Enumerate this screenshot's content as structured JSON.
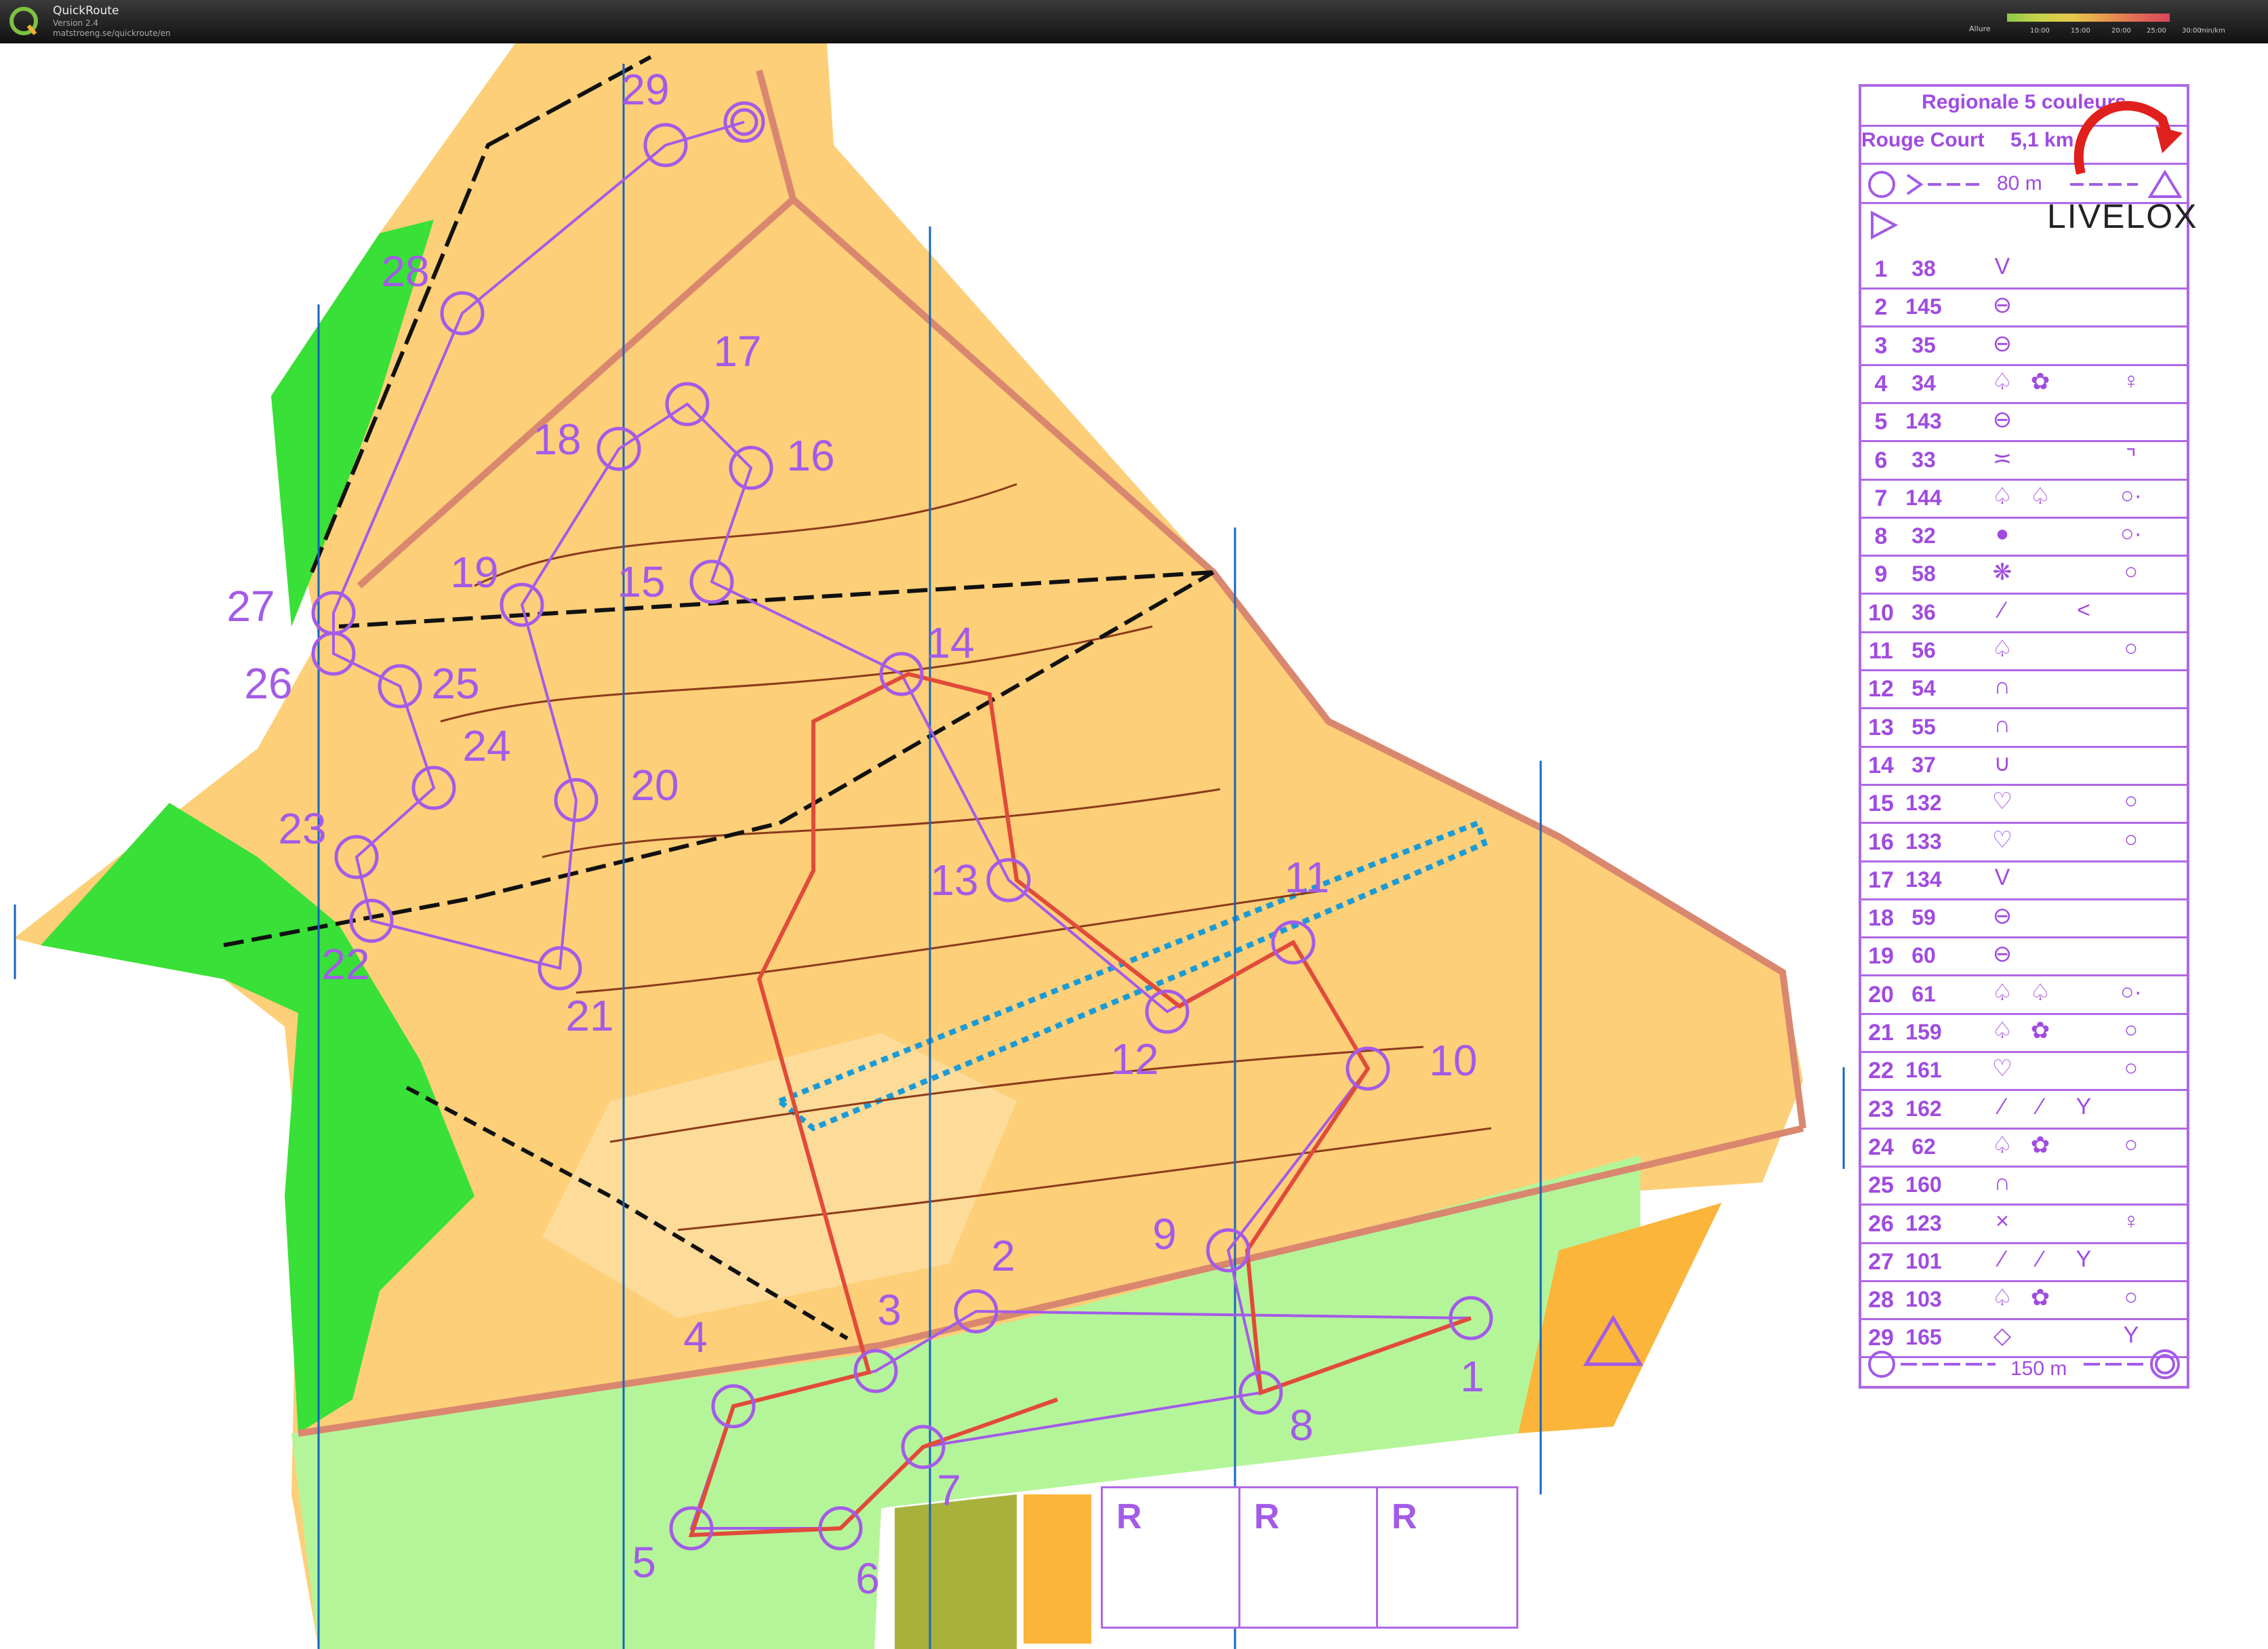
{
  "app": {
    "title": "QuickRoute",
    "version": "Version 2.4",
    "url": "matstroeng.se/quickroute/en",
    "logo_letter": "Q"
  },
  "pace_legend": {
    "label": "Allure",
    "ticks": [
      "10:00",
      "15:00",
      "20:00",
      "25:00",
      "30:00"
    ],
    "unit": "min/km"
  },
  "course": {
    "event": "Regionale 5 couleurs",
    "name": "Rouge Court",
    "distance": "5,1 km",
    "start_leg": "80 m",
    "finish_leg": "150 m",
    "controls": [
      {
        "n": "1",
        "code": "38",
        "c1": "V",
        "c2": "",
        "c3": "",
        "c4": ""
      },
      {
        "n": "2",
        "code": "145",
        "c1": "⊖",
        "c2": "",
        "c3": "",
        "c4": ""
      },
      {
        "n": "3",
        "code": "35",
        "c1": "⊖",
        "c2": "",
        "c3": "",
        "c4": ""
      },
      {
        "n": "4",
        "code": "34",
        "c1": "♤",
        "c2": "✿",
        "c3": "",
        "c4": "♀"
      },
      {
        "n": "5",
        "code": "143",
        "c1": "⊖",
        "c2": "",
        "c3": "",
        "c4": ""
      },
      {
        "n": "6",
        "code": "33",
        "c1": "≍",
        "c2": "",
        "c3": "",
        "c4": "⌝"
      },
      {
        "n": "7",
        "code": "144",
        "c1": "♤",
        "c2": "♤",
        "c3": "",
        "c4": "○·"
      },
      {
        "n": "8",
        "code": "32",
        "c1": "●",
        "c2": "",
        "c3": "",
        "c4": "○·"
      },
      {
        "n": "9",
        "code": "58",
        "c1": "❋",
        "c2": "",
        "c3": "",
        "c4": "○"
      },
      {
        "n": "10",
        "code": "36",
        "c1": "⁄",
        "c2": "",
        "c3": "<",
        "c4": ""
      },
      {
        "n": "11",
        "code": "56",
        "c1": "♤",
        "c2": "",
        "c3": "",
        "c4": "○"
      },
      {
        "n": "12",
        "code": "54",
        "c1": "∩",
        "c2": "",
        "c3": "",
        "c4": ""
      },
      {
        "n": "13",
        "code": "55",
        "c1": "∩",
        "c2": "",
        "c3": "",
        "c4": ""
      },
      {
        "n": "14",
        "code": "37",
        "c1": "∪",
        "c2": "",
        "c3": "",
        "c4": ""
      },
      {
        "n": "15",
        "code": "132",
        "c1": "♡",
        "c2": "",
        "c3": "",
        "c4": "○"
      },
      {
        "n": "16",
        "code": "133",
        "c1": "♡",
        "c2": "",
        "c3": "",
        "c4": "○"
      },
      {
        "n": "17",
        "code": "134",
        "c1": "V",
        "c2": "",
        "c3": "",
        "c4": ""
      },
      {
        "n": "18",
        "code": "59",
        "c1": "⊖",
        "c2": "",
        "c3": "",
        "c4": ""
      },
      {
        "n": "19",
        "code": "60",
        "c1": "⊖",
        "c2": "",
        "c3": "",
        "c4": ""
      },
      {
        "n": "20",
        "code": "61",
        "c1": "♤",
        "c2": "♤",
        "c3": "",
        "c4": "○·"
      },
      {
        "n": "21",
        "code": "159",
        "c1": "♤",
        "c2": "✿",
        "c3": "",
        "c4": "○"
      },
      {
        "n": "22",
        "code": "161",
        "c1": "♡",
        "c2": "",
        "c3": "",
        "c4": "○"
      },
      {
        "n": "23",
        "code": "162",
        "c1": "⁄",
        "c2": "⁄",
        "c3": "Y",
        "c4": ""
      },
      {
        "n": "24",
        "code": "62",
        "c1": "♤",
        "c2": "✿",
        "c3": "",
        "c4": "○"
      },
      {
        "n": "25",
        "code": "160",
        "c1": "∩",
        "c2": "",
        "c3": "",
        "c4": ""
      },
      {
        "n": "26",
        "code": "123",
        "c1": "×",
        "c2": "",
        "c3": "",
        "c4": "♀"
      },
      {
        "n": "27",
        "code": "101",
        "c1": "⁄",
        "c2": "⁄",
        "c3": "Y",
        "c4": ""
      },
      {
        "n": "28",
        "code": "103",
        "c1": "♤",
        "c2": "✿",
        "c3": "",
        "c4": "○"
      },
      {
        "n": "29",
        "code": "165",
        "c1": "◇",
        "c2": "",
        "c3": "",
        "c4": "Y"
      }
    ]
  },
  "branding": {
    "livelox": "LIVELOX"
  },
  "restricted": {
    "letters": [
      "R",
      "R",
      "R"
    ]
  },
  "map_controls": [
    "1",
    "2",
    "3",
    "4",
    "5",
    "6",
    "7",
    "8",
    "9",
    "10",
    "11",
    "12",
    "13",
    "14",
    "15",
    "16",
    "17",
    "18",
    "19",
    "20",
    "21",
    "22",
    "23",
    "24",
    "25",
    "26",
    "27",
    "28",
    "29"
  ],
  "colors": {
    "open_land": "#fdcf78",
    "rough_open": "#fcdfa6",
    "forest_green": "#38e038",
    "light_green": "#b5f59a",
    "course_purple": "#a35be8",
    "route_red": "#e24a3a",
    "path_black": "#111111",
    "contour_brown": "#8b3b1a",
    "road_brown": "#d9876f",
    "water_blue": "#1a9bd6",
    "north_lines": "#1565c0"
  }
}
